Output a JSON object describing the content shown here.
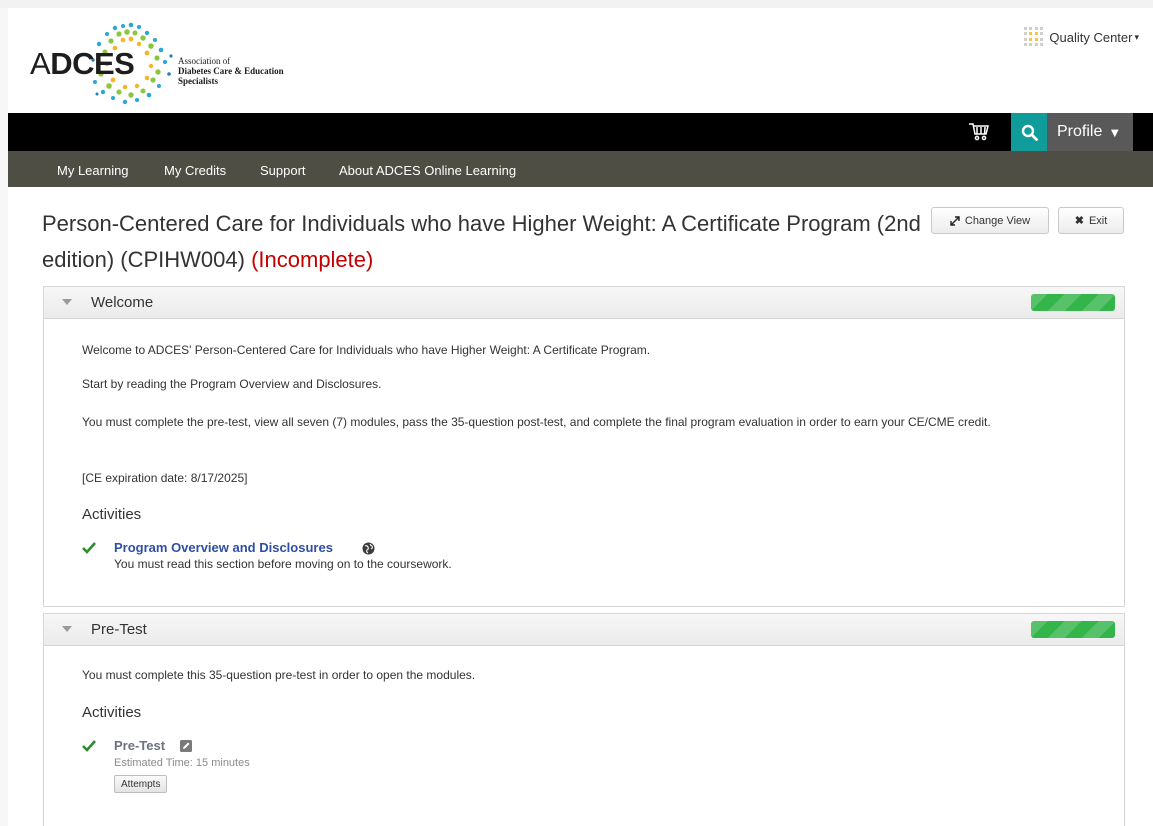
{
  "header": {
    "logo_text": "ADCES",
    "logo_lines": [
      "Association of",
      "Diabetes Care & Education",
      "Specialists"
    ],
    "quality_center": "Quality Center"
  },
  "topbar": {
    "profile_label": "Profile"
  },
  "nav": {
    "items": [
      {
        "label": "My Learning"
      },
      {
        "label": "My Credits"
      },
      {
        "label": "Support"
      },
      {
        "label": "About ADCES Online Learning"
      }
    ]
  },
  "course": {
    "title": "Person-Centered Care for Individuals who have Higher Weight: A Certificate Program (2nd edition) (CPIHW004)",
    "status": "(Incomplete)",
    "change_view_label": "Change View",
    "exit_label": "Exit"
  },
  "sections": [
    {
      "title": "Welcome",
      "progress": 1.0,
      "paragraphs": [
        "Welcome to ADCES' Person-Centered Care for Individuals who have Higher Weight: A Certificate Program.",
        "Start by reading the Program Overview and Disclosures.",
        "You must complete the pre-test, view all seven (7) modules, pass the 35-question post-test, and complete the final program evaluation in order to earn your CE/CME credit.",
        "[CE expiration date: 8/17/2025]"
      ],
      "activities_heading": "Activities",
      "activities": [
        {
          "title": "Program Overview and Disclosures",
          "description": "You must read this section before moving on to the coursework.",
          "icon": "globe-icon"
        }
      ]
    },
    {
      "title": "Pre-Test",
      "progress": 1.0,
      "paragraphs": [
        "You must complete this 35-question pre-test in order to open the modules."
      ],
      "activities_heading": "Activities",
      "activities": [
        {
          "title": "Pre-Test",
          "estimated_time": "Estimated Time: 15 minutes",
          "button_label": "Attempts",
          "icon": "edit-icon"
        }
      ]
    }
  ],
  "colors": {
    "teal": "#0f9c9a",
    "nav_bg": "#4f4e45",
    "status_red": "#c40000",
    "link_blue": "#2e4fa3",
    "progress_green": "#33b54a"
  }
}
